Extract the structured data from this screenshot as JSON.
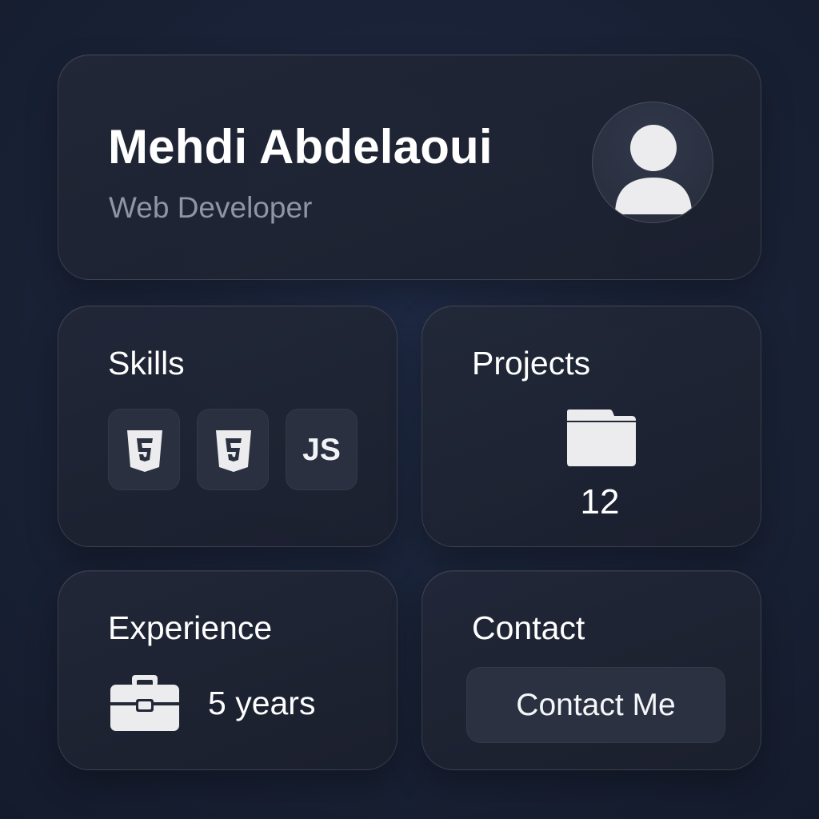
{
  "profile": {
    "name": "Mehdi Abdelaoui",
    "role": "Web Developer"
  },
  "skills": {
    "title": "Skills",
    "items": [
      {
        "icon": "html5-icon"
      },
      {
        "icon": "html5-icon"
      },
      {
        "label": "JS",
        "icon": "javascript-icon"
      }
    ]
  },
  "projects": {
    "title": "Projects",
    "icon": "folder-icon",
    "count": "12"
  },
  "experience": {
    "title": "Experience",
    "icon": "briefcase-icon",
    "value": "5 years"
  },
  "contact": {
    "title": "Contact",
    "button_label": "Contact Me"
  },
  "colors": {
    "background": "#1a2338",
    "card": "#222838",
    "tile": "#2a3040",
    "text": "#ffffff",
    "muted_text": "#8d95a7",
    "icon": "#ececee"
  }
}
